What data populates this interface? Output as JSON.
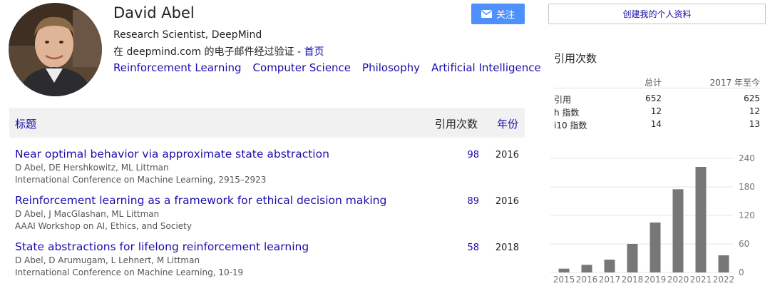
{
  "profile": {
    "name": "David Abel",
    "affiliation": "Research Scientist, DeepMind",
    "email_prefix": "在 deepmind.com 的电子邮件经过验证 - ",
    "homepage_label": "首页",
    "interests": [
      "Reinforcement Learning",
      "Computer Science",
      "Philosophy",
      "Artificial Intelligence"
    ]
  },
  "buttons": {
    "follow_label": "关注",
    "create_profile_label": "创建我的个人资料"
  },
  "table": {
    "header_title": "标题",
    "header_cited": "引用次数",
    "header_year": "年份",
    "papers": [
      {
        "title": "Near optimal behavior via approximate state abstraction",
        "authors": "D Abel, DE Hershkowitz, ML Littman",
        "venue": "International Conference on Machine Learning, 2915–2923",
        "cited": "98",
        "year": "2016"
      },
      {
        "title": "Reinforcement learning as a framework for ethical decision making",
        "authors": "D Abel, J MacGlashan, ML Littman",
        "venue": "AAAI Workshop on AI, Ethics, and Society",
        "cited": "89",
        "year": "2016"
      },
      {
        "title": "State abstractions for lifelong reinforcement learning",
        "authors": "D Abel, D Arumugam, L Lehnert, M Littman",
        "venue": "International Conference on Machine Learning, 10-19",
        "cited": "58",
        "year": "2018"
      }
    ]
  },
  "cited_by": {
    "title": "引用次数",
    "col_all": "总计",
    "col_since": "2017 年至今",
    "rows": [
      {
        "label": "引用",
        "all": "652",
        "since": "625"
      },
      {
        "label": "h 指数",
        "all": "12",
        "since": "12"
      },
      {
        "label": "i10 指数",
        "all": "14",
        "since": "13"
      }
    ]
  },
  "chart_data": {
    "type": "bar",
    "categories": [
      "2015",
      "2016",
      "2017",
      "2018",
      "2019",
      "2020",
      "2021",
      "2022"
    ],
    "values": [
      8,
      16,
      27,
      60,
      105,
      175,
      222,
      36
    ],
    "ylim": [
      0,
      240
    ],
    "yticks": [
      "0",
      "60",
      "120",
      "180",
      "240"
    ],
    "grid": true,
    "bar_color": "#777777"
  },
  "colors": {
    "link": "#1a0dab",
    "follow_bg": "#4d90fe",
    "table_header_bg": "#f1f1f1"
  },
  "icons": {
    "follow": "mail-icon"
  }
}
